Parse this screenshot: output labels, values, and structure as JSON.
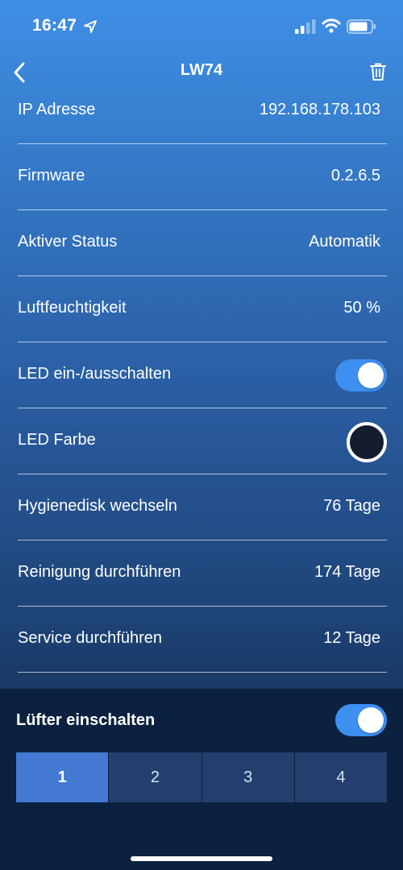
{
  "status_bar": {
    "time": "16:47"
  },
  "nav": {
    "title": "LW74"
  },
  "rows": [
    {
      "label": "IP Adresse",
      "value": "192.168.178.103"
    },
    {
      "label": "Firmware",
      "value": "0.2.6.5"
    },
    {
      "label": "Aktiver Status",
      "value": "Automatik"
    },
    {
      "label": "Luftfeuchtigkeit",
      "value": "50 %"
    },
    {
      "label": "LED ein-/ausschalten",
      "toggle_on": true
    },
    {
      "label": "LED Farbe",
      "color": "#141c2e"
    },
    {
      "label": "Hygienedisk wechseln",
      "value": "76 Tage"
    },
    {
      "label": "Reinigung durchführen",
      "value": "174 Tage"
    },
    {
      "label": "Service durchführen",
      "value": "12 Tage"
    }
  ],
  "fan": {
    "label": "Lüfter einschalten",
    "toggle_on": true,
    "levels": [
      "1",
      "2",
      "3",
      "4"
    ],
    "selected_level": "1"
  },
  "colors": {
    "accent": "#3d8ff0",
    "segment_active": "#4479d3",
    "segment_inactive": "#243f6e",
    "panel_bg": "#0c213f"
  }
}
